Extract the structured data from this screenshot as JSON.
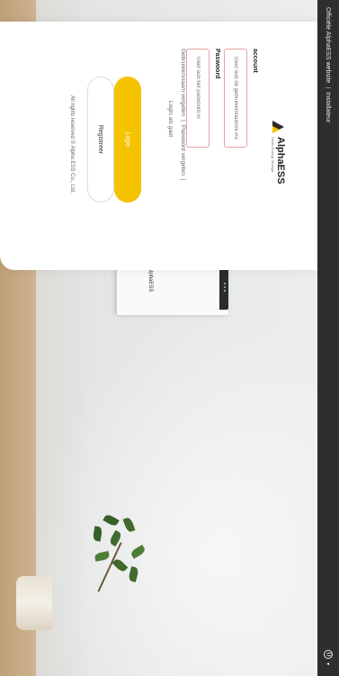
{
  "topbar": {
    "official_link": "Officiële AlphaESS website",
    "separator": "|",
    "installer_link": "Installateur",
    "language_icon": "globe-icon",
    "language_caret": "▾"
  },
  "brand": {
    "name": "AlphaESS",
    "tagline": "Smart Energy Storage"
  },
  "device": {
    "brand": "AlphaESS"
  },
  "form": {
    "account_label": "account",
    "account_placeholder": "Geef aub de gebruikersnaam/e-mail in",
    "password_label": "Paswoord",
    "password_placeholder": "Geef aub het paswoord in",
    "forgot_username": "Gebruikersnaam vergeten",
    "links_separator": "|",
    "forgot_password": "Paswoord vergeten",
    "login_guest": "Login als gast",
    "login_button": "Login",
    "register_button": "Registreer"
  },
  "footer": {
    "copyright": "All rights reserved © Alpha ESS Co., Ltd."
  },
  "colors": {
    "accent": "#f6c300",
    "topbar": "#2e2e2e",
    "input_border": "#e7a3a3"
  }
}
